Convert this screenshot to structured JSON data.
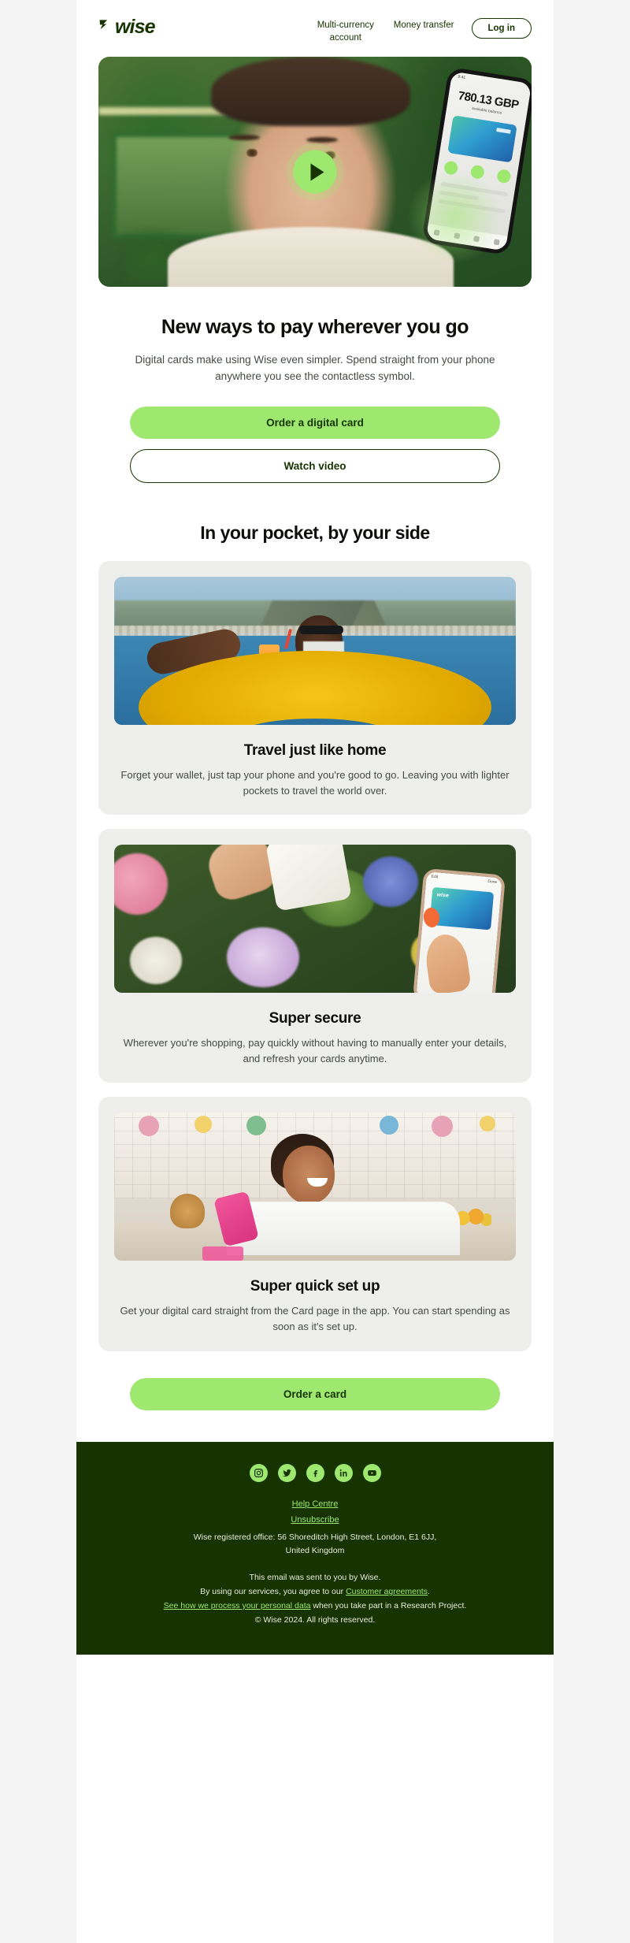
{
  "header": {
    "logo_text": "wise",
    "logo_icon": "wise-flag-icon",
    "nav": [
      {
        "label": "Multi-currency account"
      },
      {
        "label": "Money transfer"
      }
    ],
    "login_label": "Log in"
  },
  "hero": {
    "play_icon": "play-icon",
    "phone": {
      "status_time": "9:41",
      "amount": "780.13 GBP",
      "sub": "available balance",
      "card_brand": "wise",
      "tab_count": 4,
      "action_count": 3
    }
  },
  "intro": {
    "heading": "New ways to pay wherever you go",
    "body": "Digital cards make using Wise even simpler. Spend straight from your phone anywhere you see the contactless symbol.",
    "primary_cta": "Order a digital card",
    "secondary_cta": "Watch video"
  },
  "features": {
    "heading": "In your pocket, by your side",
    "cards": [
      {
        "image_name": "pool-float-photo",
        "title": "Travel just like home",
        "body": "Forget your wallet, just tap your phone and you're good to go. Leaving you with lighter pockets to travel the world over."
      },
      {
        "image_name": "contactless-payment-flowers-photo",
        "title": "Super secure",
        "body": "Wherever you're shopping, pay quickly without having to manually enter your details, and refresh your cards anytime.",
        "phone": {
          "topbar_left": "Edit",
          "topbar_right": "Done",
          "card_brand": "wise",
          "check_icon": "checkmark-icon"
        }
      },
      {
        "image_name": "kitchen-woman-phone-photo",
        "title": "Super quick set up",
        "body": "Get your digital card straight from the Card page in the app. You can start spending as soon as it's set up."
      }
    ]
  },
  "final_cta": {
    "label": "Order a card"
  },
  "footer": {
    "socials": [
      {
        "name": "instagram-icon",
        "glyph": "◎"
      },
      {
        "name": "twitter-icon",
        "glyph": "ᴠ"
      },
      {
        "name": "facebook-icon",
        "glyph": "f"
      },
      {
        "name": "linkedin-icon",
        "glyph": "in"
      },
      {
        "name": "youtube-icon",
        "glyph": "▶"
      }
    ],
    "help_centre": "Help Centre",
    "unsubscribe": "Unsubscribe",
    "address_line1": "Wise registered office: 56 Shoreditch High Street, London, E1 6JJ,",
    "address_line2": "United Kingdom",
    "sent_line": "This email was sent to you by Wise.",
    "agreements_prefix": "By using our services, you agree to our ",
    "agreements_link": "Customer agreements",
    "agreements_suffix": ".",
    "privacy_link": "See how we process your personal data",
    "privacy_suffix": " when you take part in a Research Project.",
    "copyright": "© Wise 2024. All rights reserved."
  },
  "colors": {
    "brand_green": "#9fe870",
    "dark_green": "#163300",
    "page_bg": "#f4f4f4",
    "card_bg": "#eeeeec"
  }
}
